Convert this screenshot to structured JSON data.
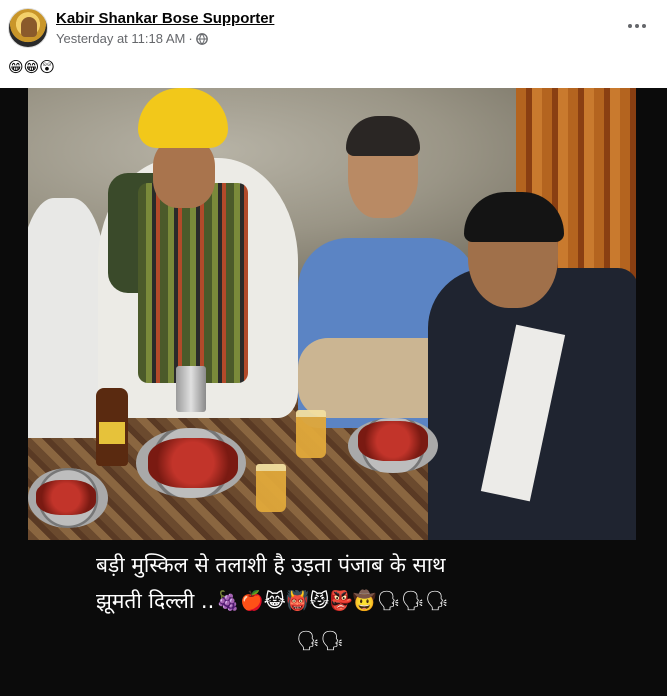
{
  "post": {
    "author": "Kabir Shankar Bose Supporter",
    "timestamp": "Yesterday at 11:18 AM",
    "separator": "·",
    "audience_icon": "globe-icon",
    "more_icon": "more-options-icon",
    "caption": "😁😁😲"
  },
  "media": {
    "overlay_line1": "बड़ी मुस्किल से तलाशी है उड़ता पंजाब के साथ",
    "overlay_line2_text": "झूमती दिल्ली ..",
    "overlay_line2_emojis": "🍇🍎😹👹😼👺🤠🗣🗣🗣",
    "overlay_line3_emojis": "🗣🗣"
  },
  "colors": {
    "author_text": "#050505",
    "meta_text": "#65676b",
    "media_background": "#0b0b0b",
    "overlay_text": "#ffffff"
  }
}
